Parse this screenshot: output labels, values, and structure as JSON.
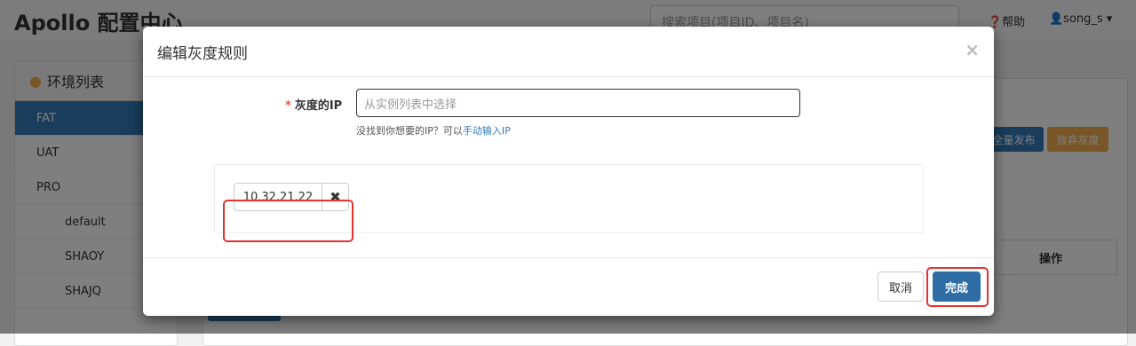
{
  "navbar": {
    "brand": "Apollo 配置中心",
    "search_placeholder": "搜索项目(项目ID、项目名)",
    "help": "❓帮助",
    "user": "👤song_s ▾"
  },
  "env_panel": {
    "title": "环境列表",
    "items": [
      {
        "label": "FAT"
      },
      {
        "label": "UAT"
      },
      {
        "label": "PRO"
      },
      {
        "label": "default"
      },
      {
        "label": "SHAOY"
      },
      {
        "label": "SHAJQ"
      }
    ]
  },
  "background": {
    "full_release": "全量发布",
    "abandon_gray": "放弃灰度",
    "operation_header": "操作"
  },
  "modal": {
    "title": "编辑灰度规则",
    "close": "×",
    "ip_label": "灰度的IP",
    "required_mark": "*",
    "ip_placeholder": "从实例列表中选择",
    "hint_text": "没找到你想要的IP？可以",
    "hint_link": "手动输入IP",
    "selected_ips": [
      {
        "ip": "10.32.21.22"
      }
    ],
    "remove_icon": "✖",
    "cancel": "取消",
    "done": "完成"
  },
  "colors": {
    "primary": "#337ab7",
    "warning": "#f0ad4e",
    "highlight": "#e5322d"
  }
}
